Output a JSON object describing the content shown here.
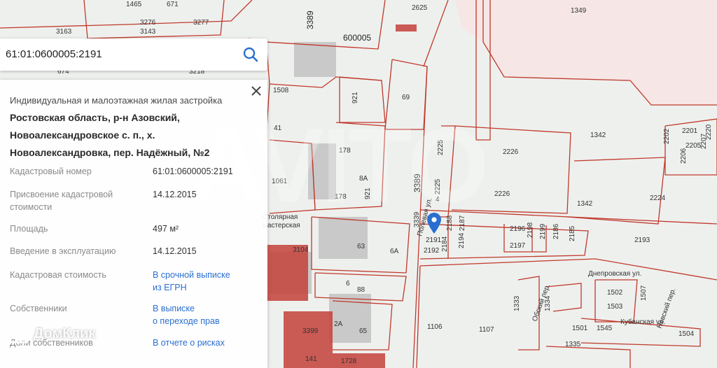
{
  "search": {
    "query": "61:01:0600005:2191"
  },
  "panel": {
    "category": "Индивидуальная и малоэтажная жилая застройка",
    "address_lines": [
      "Ростовская область, р-н Азовский,",
      "Новоалександровское с. п., х.",
      "Новоалександровка, пер. Надёжный, №2"
    ],
    "rows": [
      {
        "label": [
          "Кадастровый номер"
        ],
        "value": [
          "61:01:0600005:2191"
        ],
        "link": false
      },
      {
        "label": [
          "Присвоение кадастровой",
          "стоимости"
        ],
        "value": [
          "14.12.2015"
        ],
        "link": false
      },
      {
        "label": [
          "Площадь"
        ],
        "value": [
          "497 м²"
        ],
        "link": false
      },
      {
        "label": [
          "Введение в эксплуатацию"
        ],
        "value": [
          "14.12.2015"
        ],
        "link": false
      },
      {
        "label": [
          "Кадастровая стоимость"
        ],
        "value": [
          "В срочной выписке",
          "из ЕГРН"
        ],
        "link": true
      },
      {
        "label": [
          "Собственники"
        ],
        "value": [
          "В выписке",
          "о переходе прав"
        ],
        "link": true
      },
      {
        "label": [
          "Доли собственников"
        ],
        "value": [
          "В отчете о рисках"
        ],
        "link": true
      }
    ]
  },
  "watermark": {
    "brand": "ДомКлик",
    "overlay": "AVITO"
  },
  "map": {
    "labels": [
      "1465",
      "671",
      "3276",
      "3277",
      "3163",
      "3143",
      "3218",
      "674",
      "600005",
      "3389",
      "2625",
      "1349",
      "1508",
      "921",
      "69",
      "178",
      "8А",
      "921",
      "1061",
      "178",
      "63",
      "6А",
      "6",
      "88",
      "2А",
      "65",
      "1106",
      "1107",
      "2225",
      "2225",
      "3389",
      "4",
      "3339",
      "2226",
      "2226",
      "1342",
      "1342",
      "2224",
      "2201",
      "2205",
      "2207",
      "2202",
      "2206",
      "2220",
      "2191",
      "2192",
      "2184",
      "2188",
      "2187",
      "2194",
      "2196",
      "2197",
      "2198",
      "2199",
      "2186",
      "2185",
      "2193",
      "1502",
      "1503",
      "1507",
      "1333",
      "1334",
      "1501",
      "1545",
      "1504",
      "1335",
      "141",
      "1728",
      "3399",
      "3104",
      "41",
      "Столярная",
      "мастерская",
      "Днепровская ул.",
      "Кубанская ул.",
      "Обский пер.",
      "Невский пер.",
      "Полевая ул."
    ]
  }
}
